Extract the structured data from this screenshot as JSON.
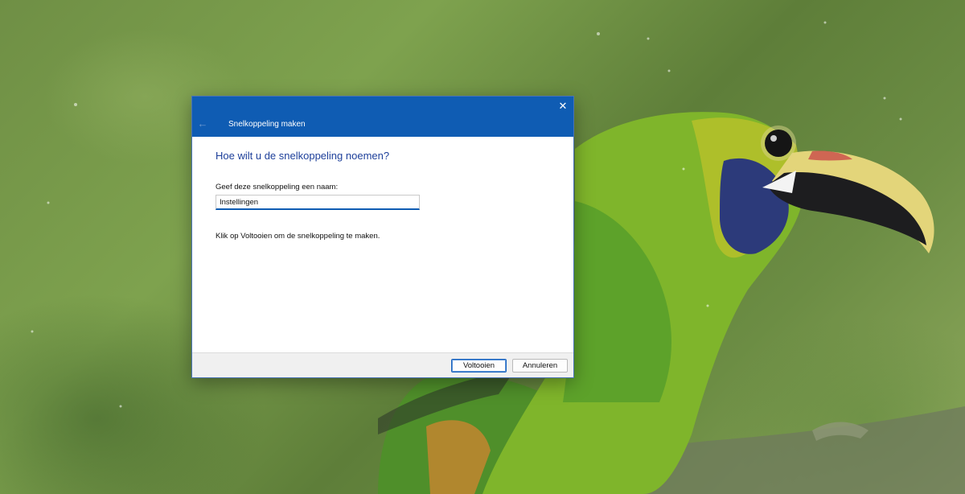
{
  "wizard": {
    "title": "Snelkoppeling maken",
    "back_icon": "arrow-left-icon",
    "close_icon": "close-icon",
    "back_glyph": "←",
    "close_glyph": "✕",
    "question": "Hoe wilt u de snelkoppeling noemen?",
    "name_label": "Geef deze snelkoppeling een naam:",
    "name_value": "Instellingen",
    "info": "Klik op Voltooien om de snelkoppeling te maken.",
    "finish_label": "Voltooien",
    "cancel_label": "Annuleren"
  },
  "colors": {
    "header": "#0f5cb3",
    "question_text": "#1d3f9a",
    "footer": "#f0f0f0"
  }
}
